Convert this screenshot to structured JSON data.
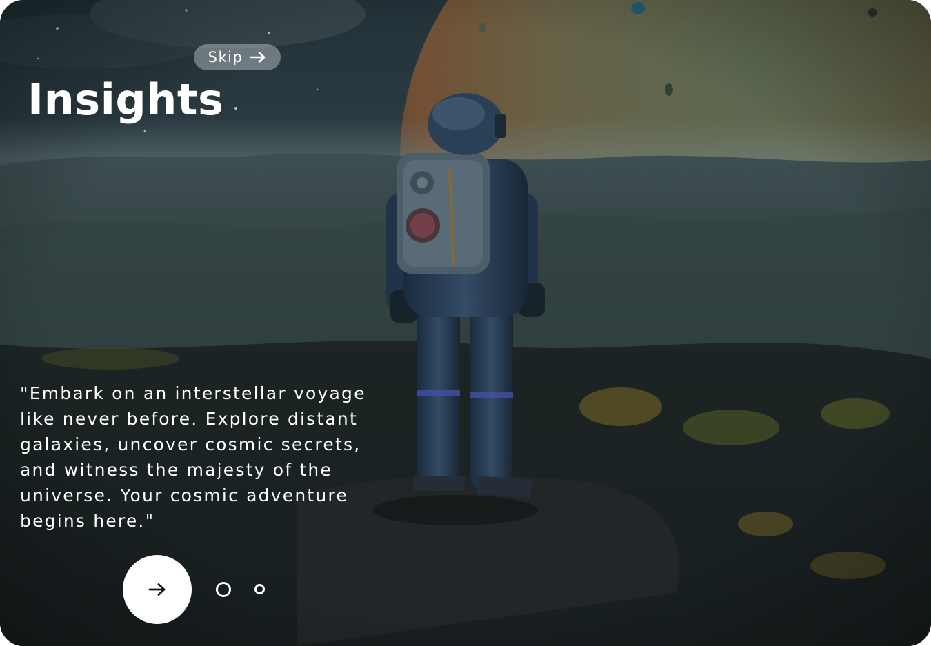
{
  "screen": {
    "title": "Insights",
    "skip_label": "Skip",
    "quote": "\"Embark on an interstellar voyage\nlike  never before. Explore distant\ngalaxies,  uncover cosmic secrets,\nand witness the majesty of the\nuniverse. Your cosmic  adventure\nbegins here.\"",
    "background_image": "astronaut-on-alien-planet",
    "pagination": {
      "total": 2,
      "current": 1
    }
  },
  "colors": {
    "text": "#ffffff",
    "skip_bg": "#aab2b6",
    "next_button_bg": "#ffffff",
    "next_button_icon": "#111111"
  },
  "icons": {
    "skip": "arrow-right-icon",
    "next": "arrow-right-icon"
  }
}
